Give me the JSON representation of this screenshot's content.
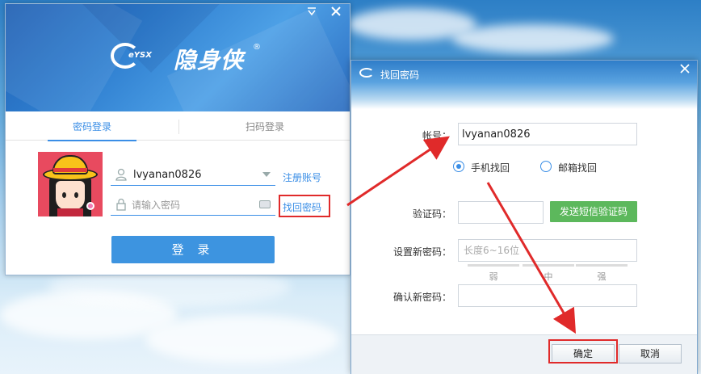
{
  "login": {
    "minimize_icon": "down-triangle-icon",
    "close_icon": "close-icon",
    "logo_mark": "eYSX",
    "logo_name": "隐身侠",
    "logo_reg": "®",
    "tabs": [
      {
        "label": "密码登录",
        "active": true
      },
      {
        "label": "扫码登录",
        "active": false
      }
    ],
    "username_value": "lvyanan0826",
    "password_placeholder": "请输入密码",
    "register_link": "注册账号",
    "find_password_link": "找回密码",
    "login_button": "登 录"
  },
  "dialog": {
    "title": "找回密码",
    "account_label": "帐号：",
    "account_value": "lvyanan0826",
    "radio_phone": "手机找回",
    "radio_email": "邮箱找回",
    "code_label": "验证码：",
    "sms_button": "发送短信验证码",
    "new_password_label": "设置新密码：",
    "new_password_placeholder": "长度6~16位",
    "strength": [
      "弱",
      "中",
      "强"
    ],
    "confirm_label": "确认新密码：",
    "ok_button": "确定",
    "cancel_button": "取消"
  },
  "colors": {
    "accent": "#3a8ee6",
    "highlight": "#e02a2a",
    "sms_button": "#5cb85c"
  }
}
